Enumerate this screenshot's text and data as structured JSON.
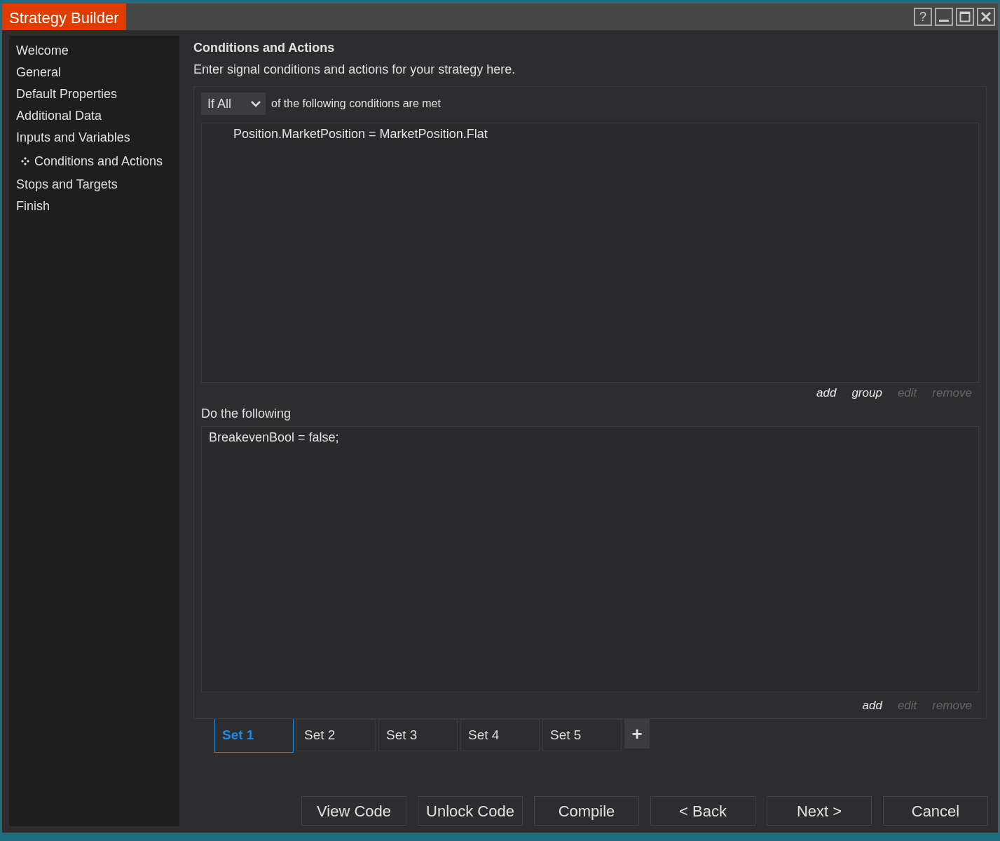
{
  "window": {
    "title": "Strategy Builder",
    "help_button": "?"
  },
  "sidebar": {
    "items": [
      {
        "label": "Welcome",
        "selected": false
      },
      {
        "label": "General",
        "selected": false
      },
      {
        "label": "Default Properties",
        "selected": false
      },
      {
        "label": "Additional Data",
        "selected": false
      },
      {
        "label": "Inputs and Variables",
        "selected": false
      },
      {
        "label": "Conditions and Actions",
        "selected": true
      },
      {
        "label": "Stops and Targets",
        "selected": false
      },
      {
        "label": "Finish",
        "selected": false
      }
    ]
  },
  "page": {
    "title": "Conditions and Actions",
    "subtitle": "Enter signal conditions and actions for your strategy here."
  },
  "conditions": {
    "match_dropdown": "If All",
    "match_text": "of the following conditions are met",
    "items": [
      "Position.MarketPosition = MarketPosition.Flat"
    ],
    "links": [
      {
        "label": "add",
        "disabled": false
      },
      {
        "label": "group",
        "disabled": false
      },
      {
        "label": "edit",
        "disabled": true
      },
      {
        "label": "remove",
        "disabled": true
      }
    ]
  },
  "actions": {
    "label": "Do the following",
    "items": [
      "BreakevenBool = false;"
    ],
    "links": [
      {
        "label": "add",
        "disabled": false
      },
      {
        "label": "edit",
        "disabled": true
      },
      {
        "label": "remove",
        "disabled": true
      }
    ]
  },
  "tabs": [
    {
      "label": "Set 1",
      "selected": true
    },
    {
      "label": "Set 2",
      "selected": false
    },
    {
      "label": "Set 3",
      "selected": false
    },
    {
      "label": "Set 4",
      "selected": false
    },
    {
      "label": "Set 5",
      "selected": false
    }
  ],
  "add_tab_button": "+",
  "buttons": [
    "View Code",
    "Unlock Code",
    "Compile",
    "< Back",
    "Next >",
    "Cancel"
  ]
}
